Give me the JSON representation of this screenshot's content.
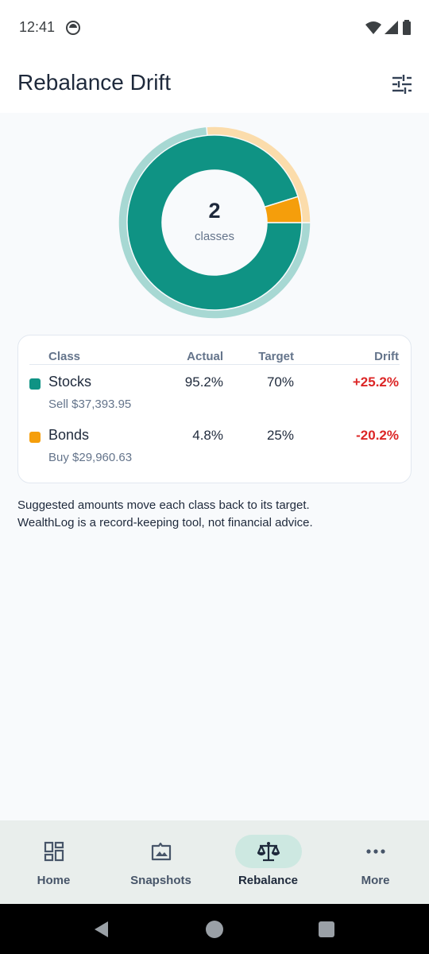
{
  "status": {
    "time": "12:41"
  },
  "app_bar": {
    "title": "Rebalance Drift"
  },
  "donut": {
    "count": "2",
    "label": "classes"
  },
  "table": {
    "headers": {
      "class": "Class",
      "actual": "Actual",
      "target": "Target",
      "drift": "Drift"
    },
    "rows": [
      {
        "name": "Stocks",
        "sub": "Sell $37,393.95",
        "actual": "95.2%",
        "target": "70%",
        "drift": "+25.2%",
        "color": "#0f9384"
      },
      {
        "name": "Bonds",
        "sub": "Buy $29,960.63",
        "actual": "4.8%",
        "target": "25%",
        "drift": "-20.2%",
        "color": "#f59e0b"
      }
    ]
  },
  "chart_data": {
    "type": "pie",
    "categories": [
      "Stocks",
      "Bonds"
    ],
    "series": [
      {
        "values": [
          95.2,
          4.8
        ]
      },
      {
        "values": [
          70,
          25
        ]
      }
    ]
  },
  "note": {
    "line1": "Suggested amounts move each class back to its target.",
    "line2": "WealthLog is a record-keeping tool, not financial advice."
  },
  "nav": {
    "home": "Home",
    "snapshots": "Snapshots",
    "rebalance": "Rebalance",
    "more": "More"
  },
  "colors": {
    "stocks": "#0f9384",
    "stocks_light": "#a7d8d3",
    "bonds": "#f59e0b",
    "bonds_light": "#fbdcab",
    "drift_negative_text": "#dc2626",
    "active_nav": "#cde8e1"
  }
}
